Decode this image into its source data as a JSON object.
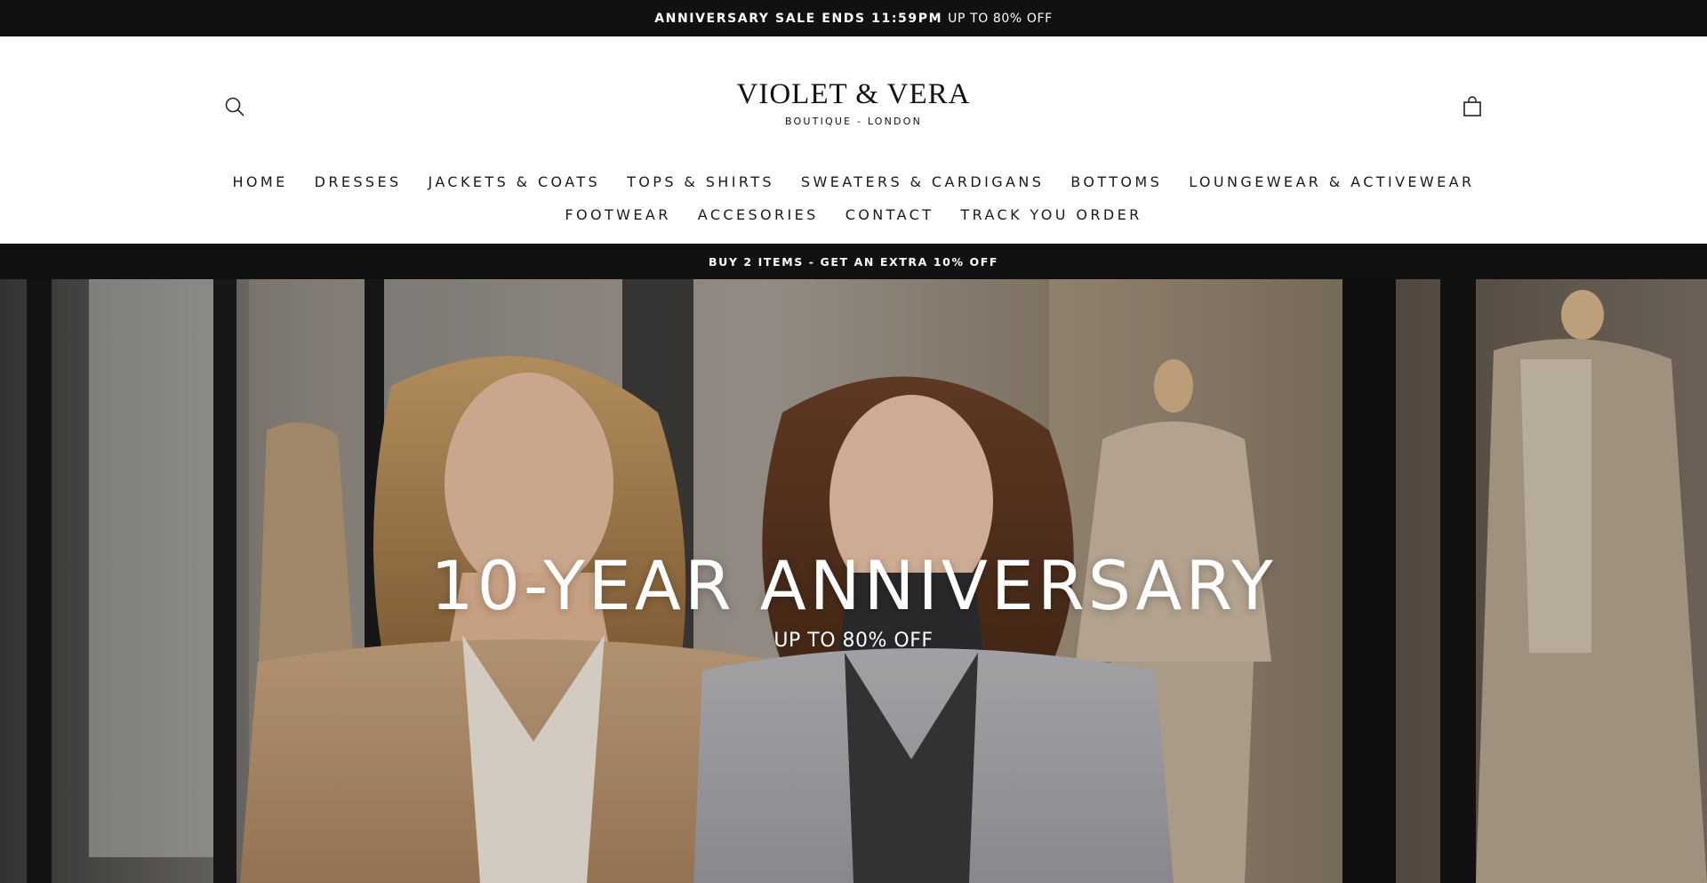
{
  "announcement": {
    "bold_text": "ANNIVERSARY SALE ENDS 11:59PM",
    "light_text": "UP TO 80% OFF"
  },
  "header": {
    "search_icon": "search-icon",
    "cart_icon": "shopping-bag-icon",
    "logo_title": "VIOLET & VERA",
    "logo_subtitle": "BOUTIQUE - LONDON"
  },
  "nav": {
    "row1": [
      {
        "label": "HOME"
      },
      {
        "label": "DRESSES"
      },
      {
        "label": "JACKETS & COATS"
      },
      {
        "label": "TOPS & SHIRTS"
      },
      {
        "label": "SWEATERS & CARDIGANS"
      },
      {
        "label": "BOTTOMS"
      },
      {
        "label": "LOUNGEWEAR & ACTIVEWEAR"
      }
    ],
    "row2": [
      {
        "label": "FOOTWEAR"
      },
      {
        "label": "ACCESORIES"
      },
      {
        "label": "CONTACT"
      },
      {
        "label": "TRACK YOU ORDER"
      }
    ]
  },
  "promo": {
    "text": "BUY 2 ITEMS - GET AN EXTRA 10% OFF"
  },
  "hero": {
    "title": "10-YEAR ANNIVERSARY",
    "subtitle": "UP TO 80% OFF"
  },
  "colors": {
    "bar_background": "#111111",
    "text_dark": "#111111",
    "hero_text": "#ffffff"
  }
}
